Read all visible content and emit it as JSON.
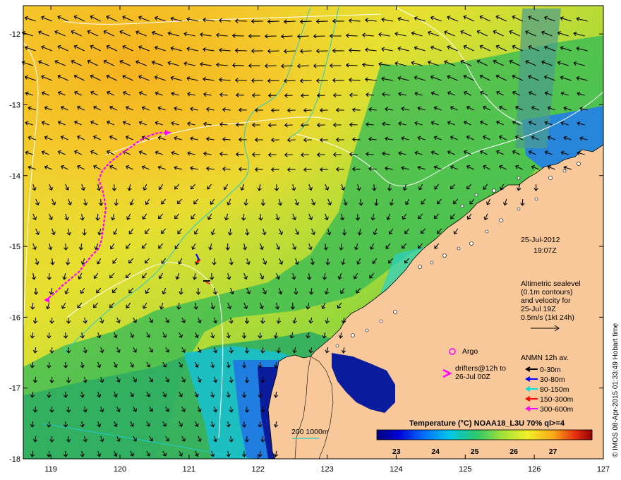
{
  "map": {
    "lon_range": [
      118.6,
      127
    ],
    "lat_range": [
      -18,
      -11.6
    ],
    "x_ticks": [
      "119",
      "120",
      "121",
      "122",
      "123",
      "124",
      "125",
      "126",
      "127"
    ],
    "y_ticks": [
      "-12",
      "-13",
      "-14",
      "-15",
      "-16",
      "-17",
      "-18"
    ],
    "date": "25-Jul-2012",
    "time": "19:07Z",
    "altimetry_note": [
      "Altimetric sealevel",
      "(0.1m contours)",
      "and velocity for",
      "25-Jul 19Z",
      "0.5m/s (1kt 24h)"
    ],
    "argo_label": "Argo",
    "drifter_label": [
      "drifters@12h to",
      "26-Jul 00Z"
    ],
    "anmn_title": "ANMN 12h av.",
    "anmn_items": [
      {
        "label": "0-30m",
        "color": "#000000"
      },
      {
        "label": "30-80m",
        "color": "#0000ff"
      },
      {
        "label": "80-150m",
        "color": "#00dddd"
      },
      {
        "label": "150-300m",
        "color": "#ff0000"
      },
      {
        "label": "300-600m",
        "color": "#ff00ff"
      }
    ],
    "depth_label": "200  1000m",
    "colorbar_title": "Temperature (°C) NOAA18_L3U 70% ql>=4",
    "colorbar_ticks": [
      "23",
      "24",
      "25",
      "26",
      "27"
    ],
    "colorbar_range": [
      22.5,
      28
    ],
    "credit": "© IMOS 08-Apr-2015 01:33:49 Hobart time",
    "colors": {
      "land": "#f8c89a",
      "drifter": "#ff00ff",
      "contour": "#ffffff",
      "isobath": "#22cccc"
    }
  }
}
